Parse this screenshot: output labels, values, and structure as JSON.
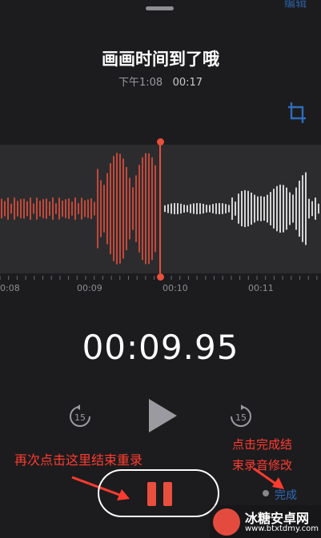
{
  "header": {
    "edit_label": "编辑",
    "title": "画画时间到了哦",
    "date": "下午1:08",
    "duration": "00:17"
  },
  "timeline": {
    "ticks": [
      "0:08",
      "00:09",
      "00:10",
      "00:11"
    ]
  },
  "player": {
    "current_time": "00:09.95",
    "skip_back_label": "15",
    "skip_forward_label": "15",
    "done_label": "完成"
  },
  "annotations": {
    "left_note": "再次点击这里结束重录",
    "right_note_line1": "点击完成结",
    "right_note_line2": "束录音修改"
  },
  "watermark": {
    "name": "冰糖安卓网",
    "url": "www.btxtdmy.com"
  },
  "colors": {
    "accent_red": "#e94f3d",
    "annotation_red": "#ff3b30",
    "link_blue": "#2f6cba",
    "background": "#1c1c1e",
    "wave_bg": "#2c2c2e"
  },
  "icons": [
    "grabber-icon",
    "crop-icon",
    "skip-back-15-icon",
    "play-icon",
    "skip-forward-15-icon",
    "pause-icon"
  ]
}
